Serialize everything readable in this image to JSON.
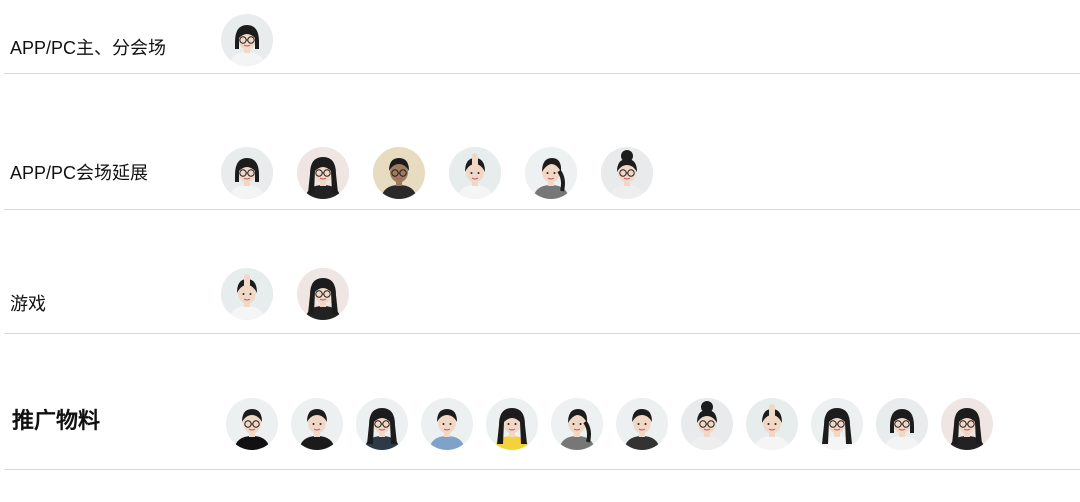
{
  "rows": [
    {
      "label": "APP/PC主、分会场",
      "style": "normal",
      "avatars": [
        "avatar-woman-glasses-bob"
      ]
    },
    {
      "label": "APP/PC会场延展",
      "style": "normal",
      "avatars": [
        "avatar-woman-glasses-bob",
        "avatar-woman-long-hair-profile",
        "avatar-man-sunset-side",
        "avatar-woman-hand-on-head",
        "avatar-woman-braid-profile",
        "avatar-woman-bun-glasses"
      ]
    },
    {
      "label": "游戏",
      "style": "normal",
      "avatars": [
        "avatar-woman-hand-on-head",
        "avatar-woman-long-hair-profile"
      ]
    },
    {
      "label": "推广物料",
      "style": "bold",
      "avatars": [
        "avatar-man-beard-glasses",
        "avatar-man-black-tee",
        "avatar-woman-glasses-long-hair",
        "avatar-man-denim-shirt",
        "avatar-woman-yellow-top",
        "avatar-woman-braid-profile",
        "avatar-man-patterned-shirt",
        "avatar-woman-bun-glasses",
        "avatar-woman-hand-on-head",
        "avatar-woman-holding-hair",
        "avatar-woman-glasses-bob",
        "avatar-woman-long-hair-profile"
      ]
    }
  ],
  "colors": {
    "divider": "#d8d8d8",
    "avatar_bg": "#eef0f0",
    "hair": "#1c1c1c",
    "skin": "#f1d7c6"
  }
}
